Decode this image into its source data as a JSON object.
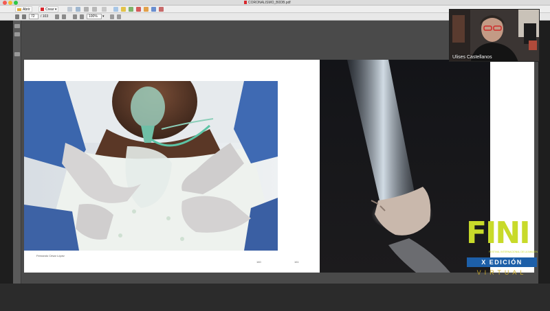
{
  "window": {
    "title": "CORONALISMO_B0DB.pdf"
  },
  "toolbar": {
    "open_label": "Abrir",
    "create_label": "Crear"
  },
  "navigation": {
    "current_page": "72",
    "total_pages": "/ 103",
    "zoom": "100%"
  },
  "document": {
    "caption": "Fernando César López",
    "page_left_number": "160",
    "page_right_number": "161"
  },
  "webcam": {
    "name": "Ulises Castellanos"
  },
  "festival_logo": {
    "letters": "FINI",
    "festival": "FESTIVAL INTERNACIONAL DE LA IMAGEN",
    "edition": "X EDICIÓN",
    "mode": "VIRTUAL"
  },
  "colors": {
    "logo_green": "#c8da2a",
    "logo_blue": "#1d5fa8",
    "logo_gold": "#c8a82a"
  }
}
